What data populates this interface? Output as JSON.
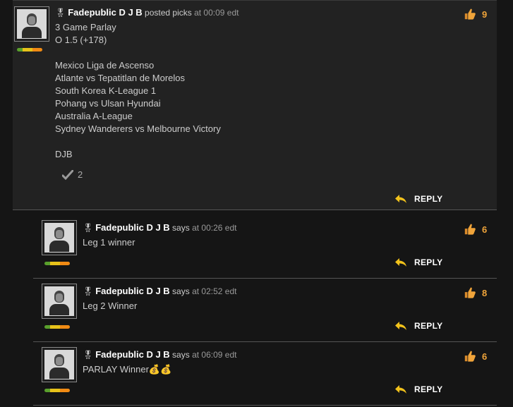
{
  "main_post": {
    "author": "Fadepublic D J B",
    "action": "posted picks",
    "time": "at 00:09 edt",
    "likes": "9",
    "lines": [
      "3 Game Parlay",
      "O 1.5 (+178)",
      "",
      "Mexico Liga de Ascenso",
      "Atlante vs Tepatitlan de Morelos",
      "South Korea K-League 1",
      "Pohang vs Ulsan Hyundai",
      "Australia A-League",
      "Sydney Wanderers vs Melbourne Victory",
      "",
      "DJB"
    ],
    "check_count": "2",
    "reply_label": "REPLY"
  },
  "replies": [
    {
      "author": "Fadepublic D J B",
      "action": "says",
      "time": "at 00:26 edt",
      "text": "Leg 1 winner",
      "likes": "6",
      "reply_label": "REPLY"
    },
    {
      "author": "Fadepublic D J B",
      "action": "says",
      "time": "at 02:52 edt",
      "text": "Leg 2 Winner",
      "likes": "8",
      "reply_label": "REPLY"
    },
    {
      "author": "Fadepublic D J B",
      "action": "says",
      "time": "at 06:09 edt",
      "text": "PARLAY Winner💰💰",
      "likes": "6",
      "reply_label": "REPLY"
    }
  ],
  "icons": {
    "medal": "🎖",
    "like": "thumbs-up-icon",
    "reply": "reply-arrow-icon",
    "check": "check-icon"
  },
  "colors": {
    "background": "#151515",
    "post_background": "#222222",
    "author": "#ffffff",
    "likes": "#f0a43a",
    "reply_arrow": "#f2c21b",
    "thumb": "#f0a43a"
  }
}
